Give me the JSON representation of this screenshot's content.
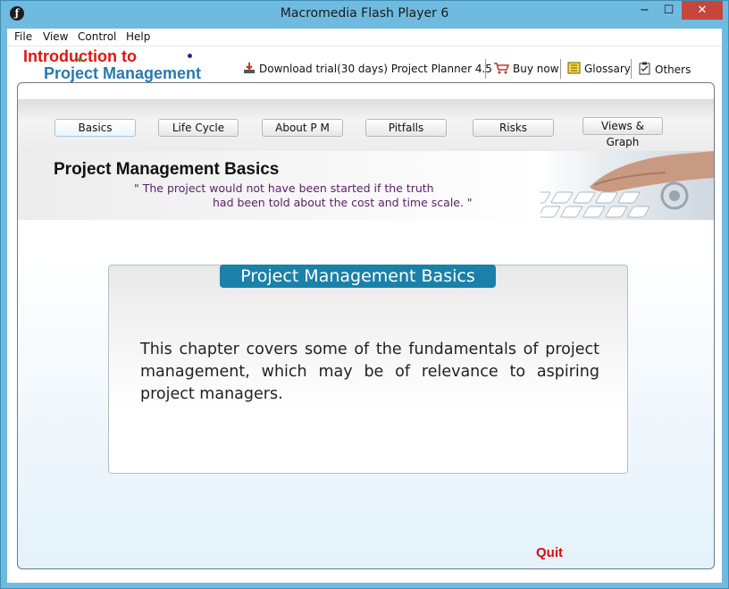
{
  "window": {
    "title": "Macromedia Flash Player 6",
    "icon": "flash-icon",
    "minimize": "−",
    "maximize": "☐",
    "close": "✕"
  },
  "menu": [
    "File",
    "View",
    "Control",
    "Help"
  ],
  "logo": {
    "line1": "Introduction to",
    "line2": "Project Management"
  },
  "toplinks": {
    "download": "Download trial(30 days) Project Planner 4.5",
    "buy": "Buy now",
    "glossary": "Glossary",
    "others": "Others"
  },
  "nav": [
    "Basics",
    "Life Cycle",
    "About P M",
    "Pitfalls",
    "Risks",
    "Views & Graph"
  ],
  "nav_active": "Basics",
  "banner": {
    "title": "Project Management Basics",
    "quote_line1": "\" The project would not have been started if the truth",
    "quote_line2": "had been told about the cost and time scale. \""
  },
  "panel": {
    "heading": "Project Management Basics",
    "body": "This chapter covers some of the fundamentals of project management, which may be of relevance to aspiring project managers."
  },
  "quit": "Quit",
  "colors": {
    "titlebar": "#6fbbe0",
    "logo_red": "#e0160c",
    "logo_blue": "#2878ae",
    "heading_blue": "#1a81a9",
    "quote_purple": "#5a1e66",
    "quit_red": "#d80c0c"
  }
}
